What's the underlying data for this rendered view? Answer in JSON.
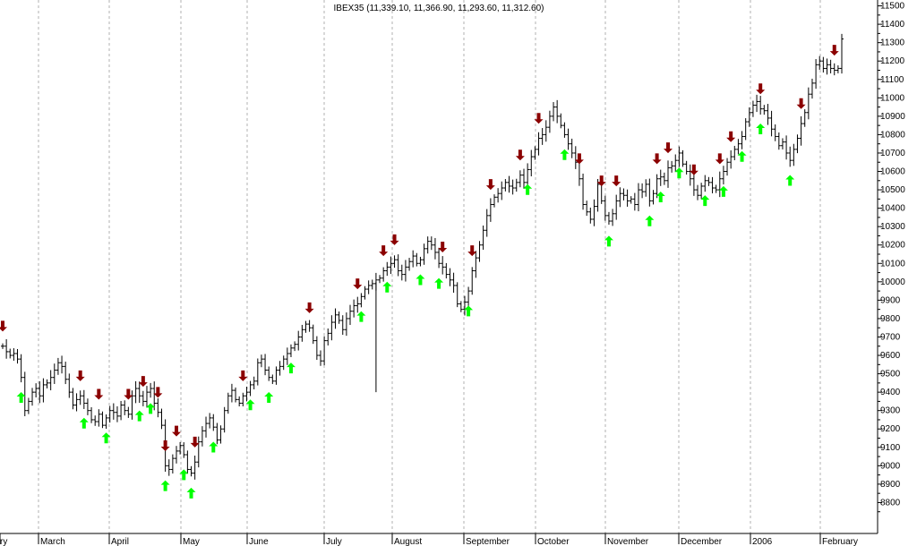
{
  "chart_data": {
    "type": "ohlc",
    "title": "IBEX35 (11,339.10, 11,366.90, 11,293.60, 11,312.60)",
    "ylim": [
      8700,
      11600
    ],
    "y_ticks": [
      8800,
      8900,
      9000,
      9100,
      9200,
      9300,
      9400,
      9500,
      9600,
      9700,
      9800,
      9900,
      10000,
      10100,
      10200,
      10300,
      10400,
      10500,
      10600,
      10700,
      10800,
      10900,
      11000,
      11100,
      11200,
      11300,
      11400,
      11500
    ],
    "x_labels": [
      "ry",
      "March",
      "April",
      "May",
      "June",
      "July",
      "August",
      "September",
      "October",
      "November",
      "December",
      "2006",
      "February"
    ],
    "grid": true,
    "colors": {
      "bar": "#000000",
      "sell_arrow": "#8b0000",
      "buy_arrow": "#00ff00",
      "grid": "#b0b0b0"
    },
    "series": [
      {
        "values": [
          9650,
          9620,
          9600,
          9610,
          9580,
          9480,
          9300,
          9350,
          9400,
          9420,
          9380,
          9440,
          9450,
          9480,
          9520,
          9560,
          9540,
          9470,
          9400,
          9330,
          9360,
          9380,
          9340,
          9300,
          9250,
          9240,
          9280,
          9220,
          9260,
          9300,
          9290,
          9270,
          9330,
          9300,
          9280,
          9380,
          9420,
          9380,
          9350,
          9400,
          9420,
          9340,
          9290,
          9220,
          9000,
          8980,
          9040,
          9080,
          9110,
          9060,
          8980,
          8960,
          9020,
          9130,
          9190,
          9230,
          9260,
          9210,
          9140,
          9200,
          9300,
          9380,
          9410,
          9360,
          9340,
          9380,
          9400,
          9440,
          9460,
          9560,
          9580,
          9520,
          9480,
          9460,
          9520,
          9540,
          9580,
          9610,
          9640,
          9660,
          9700,
          9740,
          9770,
          9750,
          9680,
          9600,
          9570,
          9680,
          9720,
          9780,
          9820,
          9790,
          9740,
          9800,
          9840,
          9870,
          9880,
          9920,
          9960,
          9980,
          9990,
          10010,
          10020,
          10060,
          10080,
          10100,
          10120,
          10060,
          10040,
          10080,
          10110,
          10140,
          10100,
          10120,
          10180,
          10220,
          10200,
          10160,
          10100,
          10080,
          10040,
          10010,
          9980,
          9880,
          9850,
          9890,
          9950,
          10060,
          10130,
          10200,
          10280,
          10360,
          10420,
          10460,
          10480,
          10510,
          10540,
          10520,
          10510,
          10540,
          10580,
          10540,
          10610,
          10680,
          10720,
          10780,
          10800,
          10840,
          10900,
          10950,
          10900,
          10850,
          10800,
          10750,
          10700,
          10650,
          10560,
          10420,
          10380,
          10340,
          10410,
          10530,
          10440,
          10360,
          10330,
          10370,
          10440,
          10480,
          10470,
          10440,
          10450,
          10420,
          10500,
          10490,
          10530,
          10440,
          10480,
          10560,
          10570,
          10550,
          10620,
          10630,
          10660,
          10700,
          10640,
          10600,
          10560,
          10500,
          10470,
          10520,
          10550,
          10540,
          10510,
          10500,
          10560,
          10600,
          10650,
          10680,
          10720,
          10750,
          10790,
          10870,
          10920,
          10960,
          10980,
          10940,
          10930,
          10890,
          10830,
          10790,
          10740,
          10760,
          10700,
          10660,
          10720,
          10780,
          10860,
          10920,
          11020,
          11080,
          11180,
          11200,
          11160,
          11180,
          11160,
          11150,
          11160,
          11320
        ]
      }
    ],
    "sell_signals": [
      0,
      21,
      26,
      34,
      38,
      42,
      44,
      47,
      52,
      65,
      83,
      96,
      103,
      106,
      119,
      127,
      132,
      140,
      145,
      156,
      162,
      166,
      177,
      180,
      187,
      194,
      197,
      205,
      216,
      225,
      236
    ],
    "buy_signals": [
      5,
      22,
      28,
      37,
      40,
      44,
      49,
      51,
      57,
      67,
      72,
      78,
      97,
      104,
      113,
      118,
      126,
      142,
      152,
      164,
      175,
      178,
      183,
      190,
      195,
      200,
      205,
      213,
      231,
      240
    ]
  }
}
